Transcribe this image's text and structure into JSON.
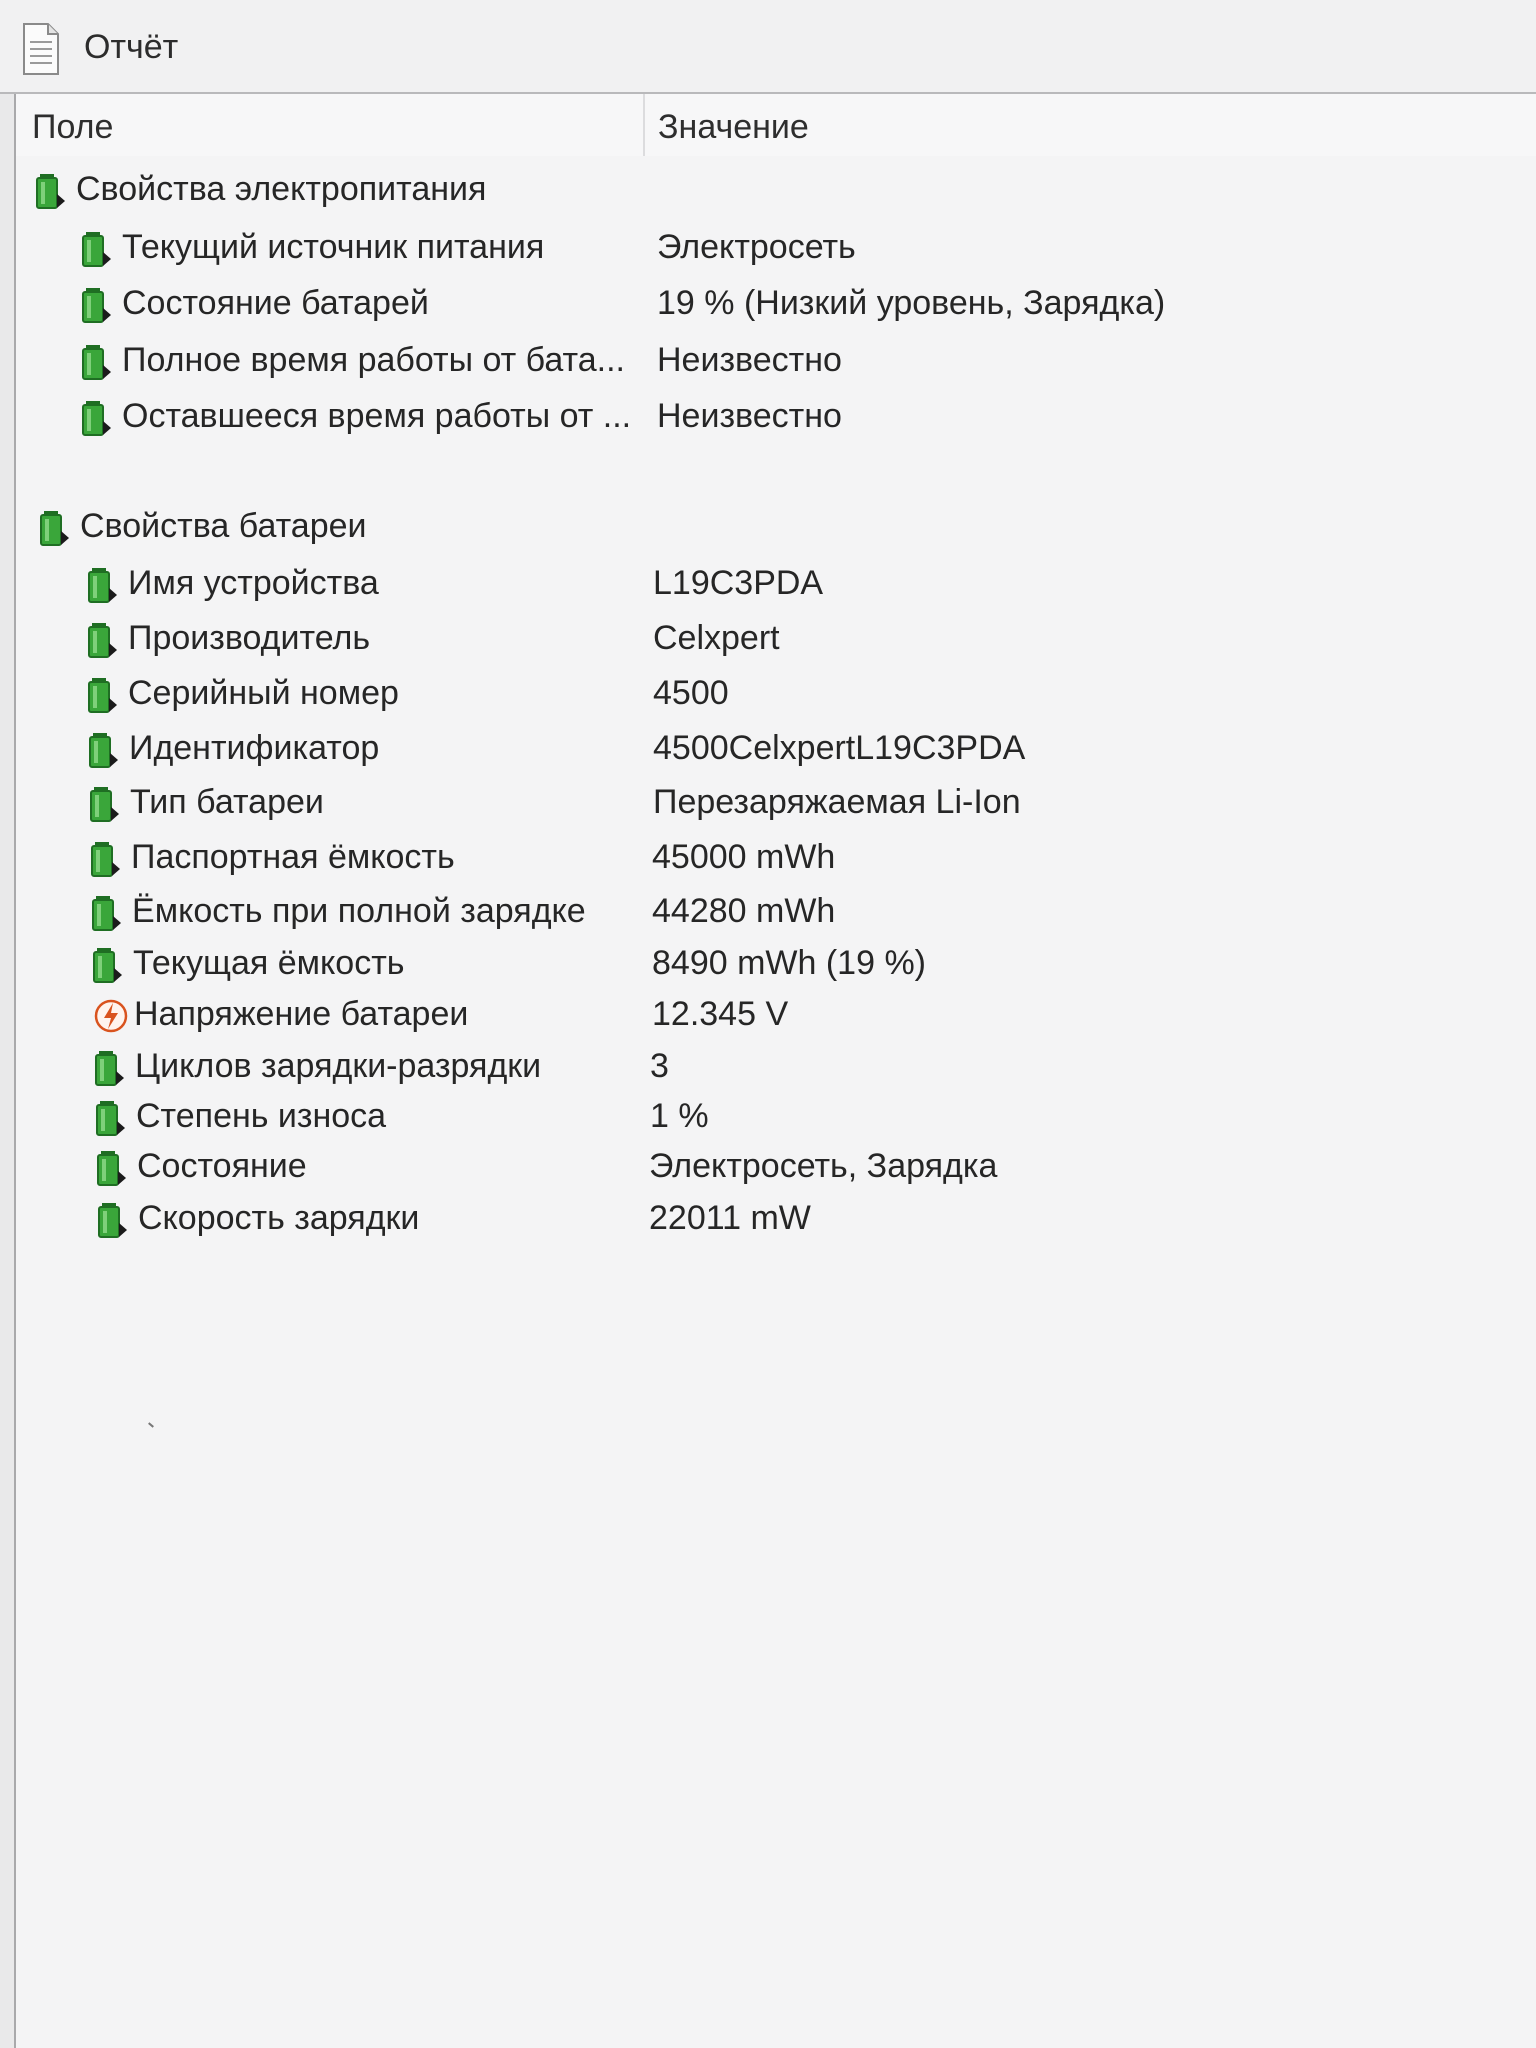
{
  "window": {
    "title": "Отчёт",
    "icon": "report-document-icon"
  },
  "columns": {
    "field": "Поле",
    "value": "Значение"
  },
  "sections": [
    {
      "title": "Свойства электропитания",
      "icon": "battery-green-icon",
      "rows": [
        {
          "field": "Текущий источник питания",
          "value": "Электросеть",
          "icon": "battery-green-icon"
        },
        {
          "field": "Состояние батарей",
          "value": "19 % (Низкий уровень, Зарядка)",
          "icon": "battery-green-icon"
        },
        {
          "field": "Полное время работы от бата...",
          "value": "Неизвестно",
          "icon": "battery-green-icon"
        },
        {
          "field": "Оставшееся время работы от ...",
          "value": "Неизвестно",
          "icon": "battery-green-icon"
        }
      ]
    },
    {
      "title": "Свойства батареи",
      "icon": "battery-green-icon",
      "rows": [
        {
          "field": "Имя устройства",
          "value": "L19C3PDA",
          "icon": "battery-green-icon"
        },
        {
          "field": "Производитель",
          "value": "Celxpert",
          "icon": "battery-green-icon"
        },
        {
          "field": "Серийный номер",
          "value": "4500",
          "icon": "battery-green-icon"
        },
        {
          "field": "Идентификатор",
          "value": "4500CelxpertL19C3PDA",
          "icon": "battery-green-icon"
        },
        {
          "field": "Тип батареи",
          "value": "Перезаряжаемая Li-Ion",
          "icon": "battery-green-icon"
        },
        {
          "field": "Паспортная ёмкость",
          "value": "45000 mWh",
          "icon": "battery-green-icon"
        },
        {
          "field": "Ёмкость при полной зарядке",
          "value": "44280 mWh",
          "icon": "battery-green-icon"
        },
        {
          "field": "Текущая ёмкость",
          "value": "8490 mWh  (19 %)",
          "icon": "battery-green-icon"
        },
        {
          "field": "Напряжение батареи",
          "value": "12.345 V",
          "icon": "voltage-lightning-icon"
        },
        {
          "field": "Циклов зарядки-разрядки",
          "value": "3",
          "icon": "battery-green-icon"
        },
        {
          "field": "Степень износа",
          "value": "1 %",
          "icon": "battery-green-icon"
        },
        {
          "field": "Состояние",
          "value": "Электросеть, Зарядка",
          "icon": "battery-green-icon"
        },
        {
          "field": "Скорость зарядки",
          "value": "22011 mW",
          "icon": "battery-green-icon"
        }
      ]
    }
  ],
  "colors": {
    "battery_green": "#3aa63a",
    "battery_dark": "#1f6e23",
    "voltage_orange": "#d9531e"
  }
}
